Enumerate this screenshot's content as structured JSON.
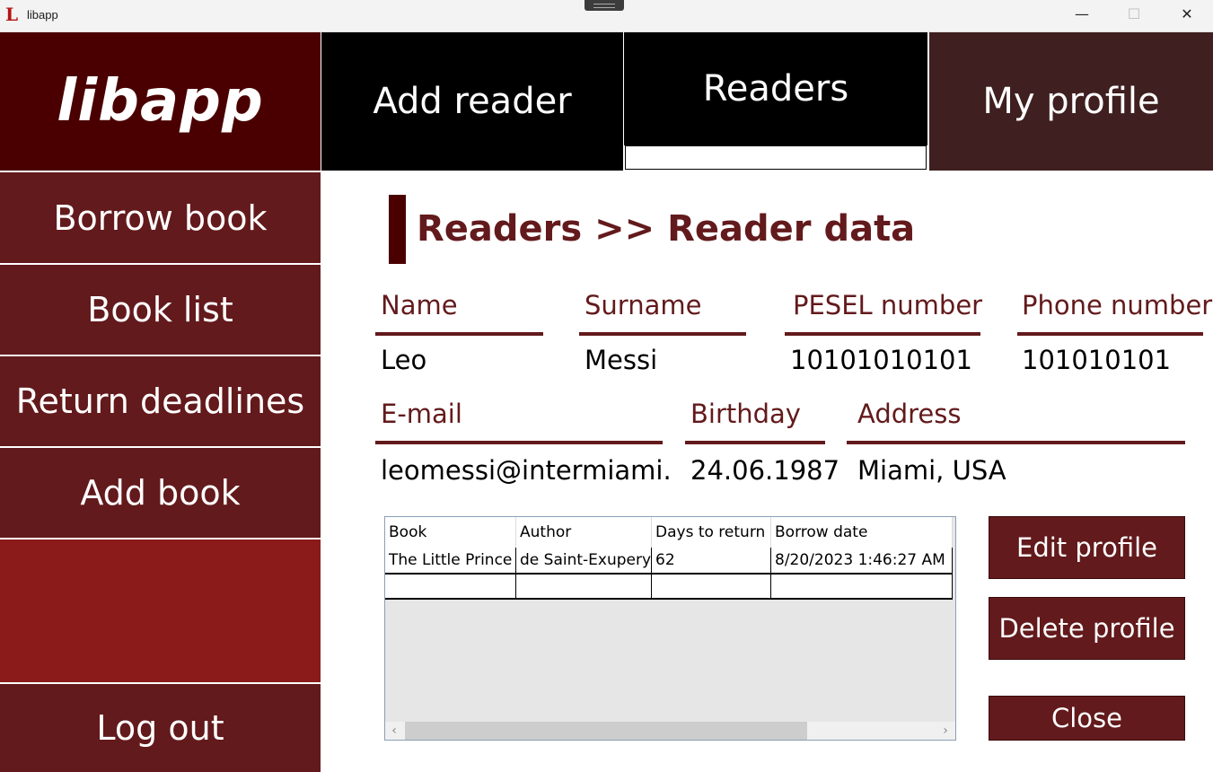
{
  "window": {
    "title": "libapp",
    "icon_letter": "L",
    "minimize": "—",
    "maximize": "☐",
    "close": "✕"
  },
  "logo": "libapp",
  "sidebar": {
    "items": [
      {
        "label": "Borrow book"
      },
      {
        "label": "Book list"
      },
      {
        "label": "Return deadlines"
      },
      {
        "label": "Add book"
      }
    ],
    "logout": "Log out"
  },
  "nav": {
    "tabs": [
      {
        "label": "Add reader"
      },
      {
        "label": "Readers"
      },
      {
        "label": "My profile"
      }
    ]
  },
  "breadcrumb": "Readers >> Reader data",
  "reader": {
    "name_label": "Name",
    "name": "Leo",
    "surname_label": "Surname",
    "surname": "Messi",
    "pesel_label": "PESEL number",
    "pesel": "10101010101",
    "phone_label": "Phone number",
    "phone": "101010101",
    "email_label": "E-mail",
    "email": "leomessi@intermiami.co",
    "birthday_label": "Birthday",
    "birthday": "24.06.1987",
    "address_label": "Address",
    "address": "Miami, USA"
  },
  "table": {
    "columns": [
      "Book",
      "Author",
      "Days to return",
      "Borrow date"
    ],
    "rows": [
      [
        "The Little Prince",
        "de Saint-Exupery",
        "62",
        "8/20/2023 1:46:27 AM"
      ],
      [
        "",
        "",
        "",
        ""
      ]
    ],
    "scroll_left": "‹",
    "scroll_right": "›"
  },
  "actions": {
    "edit": "Edit profile",
    "delete": "Delete profile",
    "close": "Close"
  },
  "colors": {
    "primary": "#631a1c",
    "dark": "#4a0000",
    "accent": "#8b1a1a",
    "profile_tab": "#3f1f1f"
  }
}
